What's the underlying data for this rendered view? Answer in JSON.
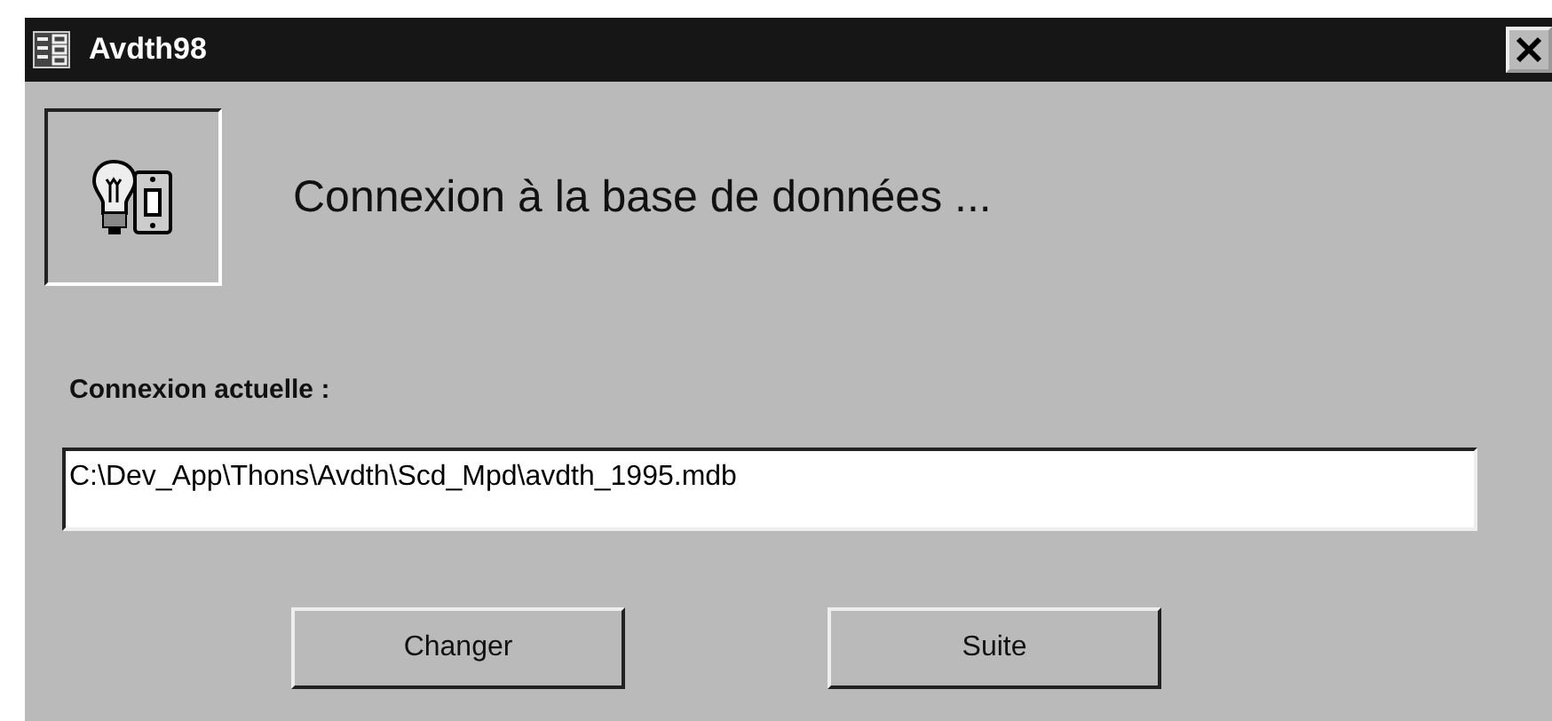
{
  "window": {
    "title": "Avdth98"
  },
  "heading": "Connexion à la base de données ...",
  "connection": {
    "label": "Connexion actuelle :",
    "value": "C:\\Dev_App\\Thons\\Avdth\\Scd_Mpd\\avdth_1995.mdb"
  },
  "buttons": [
    "Changer",
    "Suite"
  ]
}
